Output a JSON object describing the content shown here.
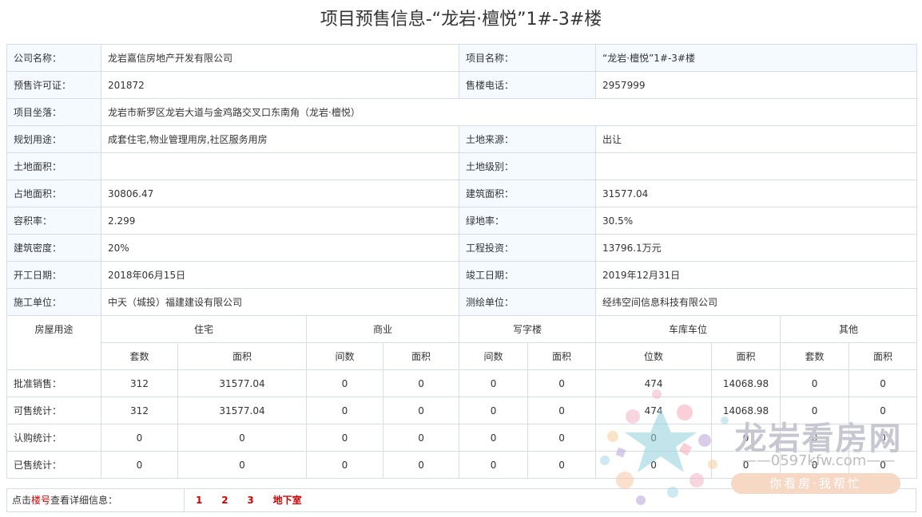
{
  "page": {
    "title": "项目预售信息-“龙岩·檀悦”1#-3#楼"
  },
  "info": {
    "company_label": "公司名称：",
    "company": "龙岩嘉信房地产开发有限公司",
    "project_label": "项目名称：",
    "project": "“龙岩·檀悦”1#-3#楼",
    "permit_label": "预售许可证：",
    "permit": "201872",
    "phone_label": "售楼电话：",
    "phone": "2957999",
    "location_label": "项目坐落：",
    "location": "龙岩市新罗区龙岩大道与金鸡路交叉口东南角（龙岩·檀悦）",
    "use_label": "规划用途：",
    "use": "成套住宅,物业管理用房,社区服务用房",
    "land_source_label": "土地来源：",
    "land_source": "出让",
    "land_area_label": "土地面积：",
    "land_area": "",
    "land_grade_label": "土地级别：",
    "land_grade": "",
    "occupy_area_label": "占地面积：",
    "occupy_area": "30806.47",
    "build_area_label": "建筑面积：",
    "build_area": "31577.04",
    "far_label": "容积率：",
    "far": "2.299",
    "green_label": "绿地率：",
    "green": "30.5%",
    "density_label": "建筑密度：",
    "density": "20%",
    "invest_label": "工程投资：",
    "invest": "13796.1万元",
    "start_label": "开工日期：",
    "start": "2018年06月15日",
    "finish_label": "竣工日期：",
    "finish": "2019年12月31日",
    "builder_label": "施工单位：",
    "builder": "中天（城投）福建建设有限公司",
    "surveyor_label": "测绘单位：",
    "surveyor": "经纬空间信息科技有限公司"
  },
  "stats": {
    "use_header": "房屋用途",
    "groups": [
      "住宅",
      "商业",
      "写字楼",
      "车库车位",
      "其他"
    ],
    "subs": [
      "套数",
      "面积",
      "间数",
      "面积",
      "间数",
      "面积",
      "位数",
      "面积",
      "套数",
      "面积"
    ],
    "rows": [
      {
        "label": "批准销售：",
        "values": [
          "312",
          "31577.04",
          "0",
          "0",
          "0",
          "0",
          "474",
          "14068.98",
          "0",
          "0"
        ]
      },
      {
        "label": "可售统计：",
        "values": [
          "312",
          "31577.04",
          "0",
          "0",
          "0",
          "0",
          "474",
          "14068.98",
          "0",
          "0"
        ]
      },
      {
        "label": "认购统计：",
        "values": [
          "0",
          "0",
          "0",
          "0",
          "0",
          "0",
          "0",
          "0",
          "0",
          "0"
        ]
      },
      {
        "label": "已售统计：",
        "values": [
          "0",
          "0",
          "0",
          "0",
          "0",
          "0",
          "0",
          "0",
          "0",
          "0"
        ]
      }
    ]
  },
  "footer": {
    "prefix": "点击",
    "highlight": "楼号",
    "suffix": "查看详细信息：",
    "links": [
      "1",
      "2",
      "3",
      "地下室"
    ]
  },
  "watermark": {
    "name": "龙岩看房网",
    "url": "——0597kfw.com——",
    "slogan": "你看房·我帮忙"
  }
}
